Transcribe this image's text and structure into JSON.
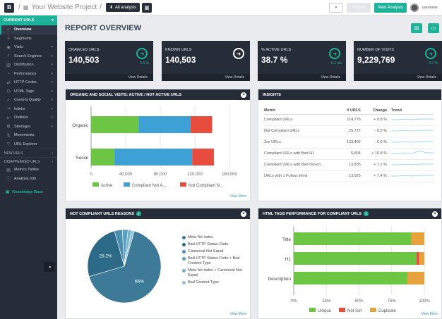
{
  "topbar": {
    "logo": "B",
    "separator": "/",
    "project_name": "Your Website Project",
    "separator2": "/",
    "analysis_label": "All analysis",
    "search_icon": "search-icon",
    "export_label": "Export",
    "new_analysis_label": "New Analysis",
    "user_name": "username"
  },
  "sidebar": {
    "current_urls_label": "CURRENT URLS",
    "items": [
      {
        "label": "Overview",
        "icon": "home-icon",
        "active": true,
        "caret": false
      },
      {
        "label": "Segments",
        "icon": "segments-icon",
        "active": false,
        "caret": false
      },
      {
        "label": "Visits",
        "icon": "eye-icon",
        "active": false,
        "caret": true
      },
      {
        "label": "Search Engines",
        "icon": "search-icon",
        "active": false,
        "caret": true
      },
      {
        "label": "Distribution",
        "icon": "distribution-icon",
        "active": false,
        "caret": true
      },
      {
        "label": "Performance",
        "icon": "performance-icon",
        "active": false,
        "caret": true
      },
      {
        "label": "HTTP Codes",
        "icon": "http-icon",
        "active": false,
        "caret": true
      },
      {
        "label": "HTML Tags",
        "icon": "tag-icon",
        "active": false,
        "caret": true
      },
      {
        "label": "Content Quality",
        "icon": "quality-icon",
        "active": false,
        "caret": true
      },
      {
        "label": "Inlinks",
        "icon": "inlinks-icon",
        "active": false,
        "caret": true
      },
      {
        "label": "Outlinks",
        "icon": "outlinks-icon",
        "active": false,
        "caret": true
      },
      {
        "label": "Sitemaps",
        "icon": "sitemap-icon",
        "active": false,
        "caret": true
      },
      {
        "label": "Movements",
        "icon": "movements-icon",
        "active": false,
        "caret": false
      },
      {
        "label": "URL Explorer",
        "icon": "filter-icon",
        "active": false,
        "caret": false
      }
    ],
    "new_urls_label": "NEW URLS",
    "disappeared_urls_label": "DISAPPEARED URLS",
    "bottom_items": [
      {
        "label": "Metrics Tables",
        "icon": "table-icon"
      },
      {
        "label": "Analysis Info",
        "icon": "info-icon"
      }
    ],
    "knowledge_base": "Knowledge Base"
  },
  "main": {
    "title": "REPORT OVERVIEW",
    "cards": [
      {
        "label": "CRAWLED URLS",
        "value": "140,503",
        "change": "- 0.6 %",
        "view": "View Details"
      },
      {
        "label": "KNOWN URLS",
        "value": "140,503",
        "change": "",
        "view": "View Details"
      },
      {
        "label": "% ACTIVE URLS",
        "value": "38.7 %",
        "change": "- 0.2 pts",
        "view": "View Details"
      },
      {
        "label": "NUMBER OF VISITS",
        "value": "9,229,769",
        "change": "- 3.7 %",
        "view": "View Details"
      }
    ],
    "organic_panel": {
      "title": "ORGANIC AND SOCIAL VISITS: ACTIVE / NOT ACTIVE URLS",
      "view_more": "View More"
    },
    "insights": {
      "title": "INSIGHTS",
      "headers": {
        "metric": "Metric",
        "urls": "# URLS",
        "change": "Change",
        "trend": "Trend"
      },
      "rows": [
        {
          "metric": "Compliant URLs",
          "urls": "114,776",
          "change": "+ 0.8 %"
        },
        {
          "metric": "Not Compliant URLs",
          "urls": "25,727",
          "change": "- 0.5 %"
        },
        {
          "metric": "2xx URLs",
          "urls": "133,462",
          "change": "- 0.0 %"
        },
        {
          "metric": "Compliant URLs with Bad H1",
          "urls": "5,804",
          "change": "+ 16.8 %"
        },
        {
          "metric": "Compliant URLs with Bad Descri...",
          "urls": "13,835",
          "change": "+ 7.1 %"
        },
        {
          "metric": "URLs with 1 Follow Inlink",
          "urls": "13,925",
          "change": "+ 7.4 %"
        }
      ],
      "view_more": "View More"
    },
    "not_compliant": {
      "title": "NOT COMPLIANT URLS REASONS",
      "badge": "i",
      "legend": [
        "Meta No-index",
        "Bad HTTP Status Code",
        "Canonical Not Equal",
        "Bad HTTP Status Code + Bad Content Type",
        "Meta No-index + Canonical Not Equal",
        "Bad Content Type"
      ],
      "view_more": "View More"
    },
    "html_tags": {
      "title": "HTML TAGS PERFORMANCE FOR COMPLIANT URLS",
      "badge": "i",
      "view_more": "View More"
    }
  },
  "colors": {
    "teal": "#1fb29b",
    "dark": "#262c38",
    "green": "#6cc644",
    "blue": "#3ea1d6",
    "red": "#e74c3c",
    "orange": "#e8a23c"
  },
  "chart_data": [
    {
      "type": "bar",
      "orientation": "horizontal",
      "stacked": true,
      "categories": [
        "Organic",
        "Social"
      ],
      "series": [
        {
          "name": "Active",
          "values": [
            55000,
            27000
          ]
        },
        {
          "name": "Compliant Not A...",
          "values": [
            60000,
            90000
          ]
        },
        {
          "name": "Not Compliant N...",
          "values": [
            25000,
            25000
          ]
        }
      ],
      "xlim": [
        0,
        160000
      ],
      "xticks": [
        "0",
        "40,000",
        "80,000",
        "120,000",
        "160,000"
      ],
      "legend": "bottom"
    },
    {
      "type": "pie",
      "slices": [
        {
          "name": "Meta No-index",
          "value": 66,
          "label": "66%"
        },
        {
          "name": "Bad HTTP Status Code",
          "value": 25.2,
          "label": "25.2%"
        },
        {
          "name": "Canonical Not Equal",
          "value": 3.5
        },
        {
          "name": "Bad HTTP Status Code + Bad Content Type",
          "value": 2.5
        },
        {
          "name": "Meta No-index + Canonical Not Equal",
          "value": 1.5
        },
        {
          "name": "Bad Content Type",
          "value": 1.3
        }
      ],
      "legend": "right"
    },
    {
      "type": "bar",
      "orientation": "horizontal",
      "stacked": true,
      "percent": true,
      "categories": [
        "Title",
        "H1",
        "Description"
      ],
      "series": [
        {
          "name": "Unique",
          "values": [
            90,
            94,
            87
          ]
        },
        {
          "name": "Not Set",
          "values": [
            0,
            2,
            0
          ]
        },
        {
          "name": "Duplicate",
          "values": [
            10,
            4,
            13
          ]
        }
      ],
      "xticks": [
        "0%",
        "25%",
        "50%",
        "75%",
        "100%"
      ],
      "legend": "bottom"
    }
  ]
}
